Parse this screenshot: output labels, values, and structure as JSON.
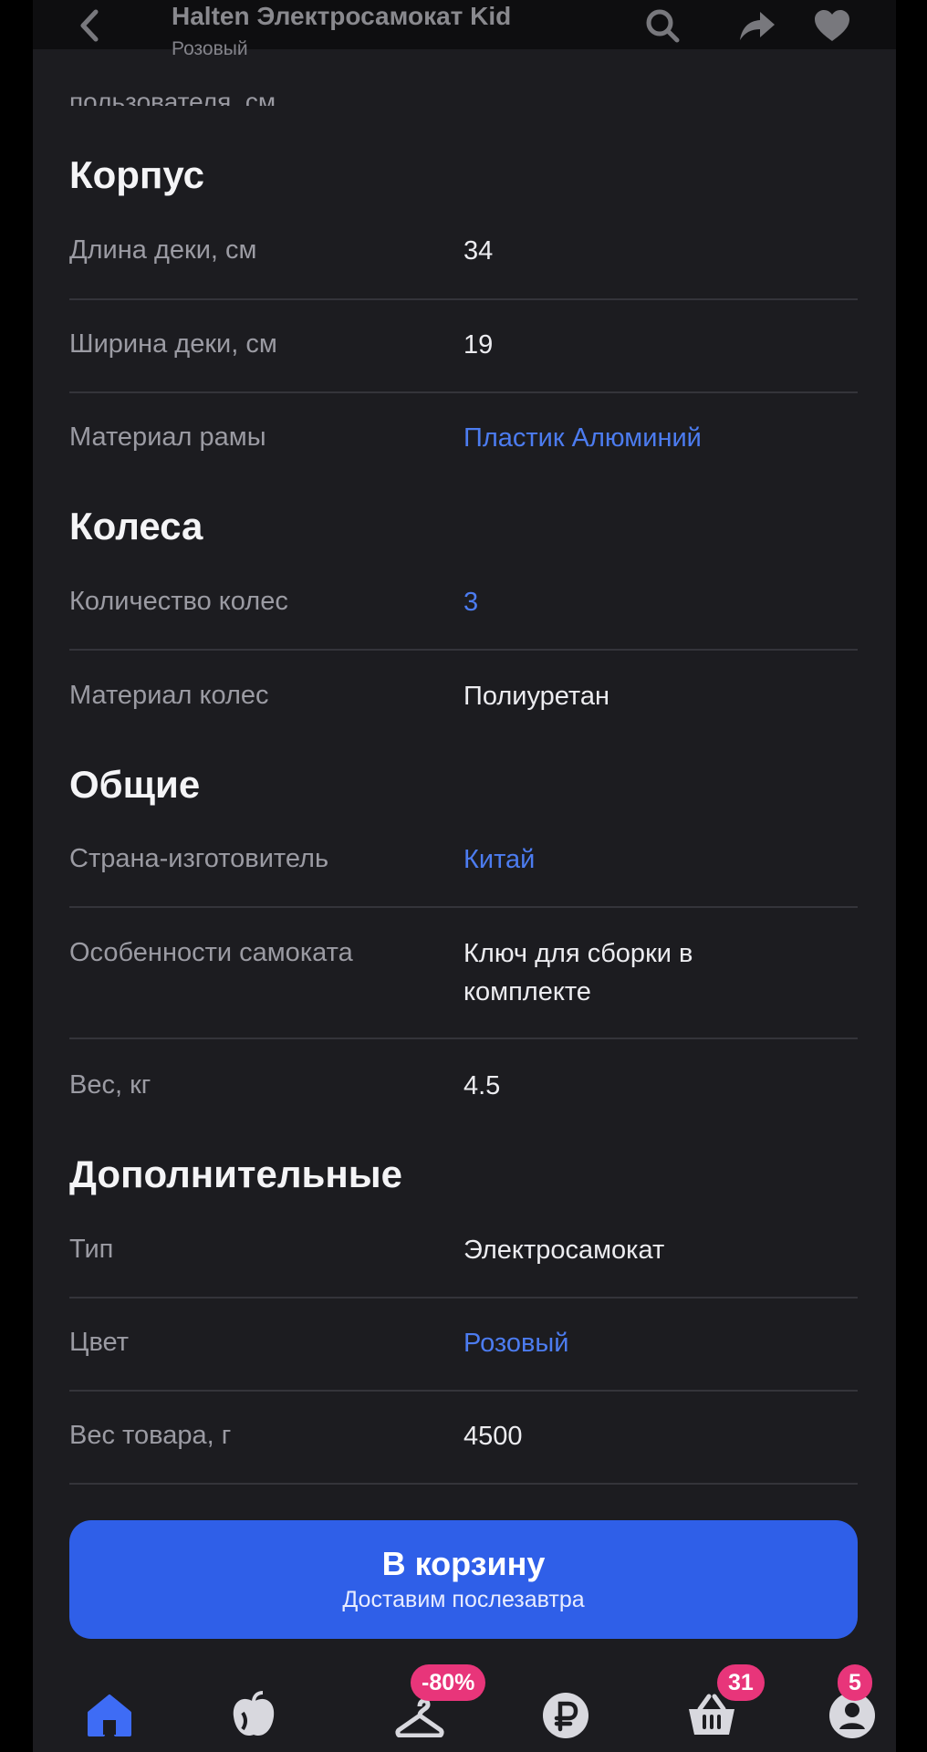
{
  "header": {
    "title": "Halten Электросамокат Kid",
    "subtitle": "Розовый",
    "cut_text": "пользователя, см"
  },
  "sections": [
    {
      "title": "Корпус",
      "rows": [
        {
          "label": "Длина деки, см",
          "value": "34",
          "link": false
        },
        {
          "label": "Ширина деки, см",
          "value": "19",
          "link": false
        },
        {
          "label": "Материал рамы",
          "value": "Пластик Алюминий",
          "link": true
        }
      ]
    },
    {
      "title": "Колеса",
      "rows": [
        {
          "label": "Количество колес",
          "value": "3",
          "link": true
        },
        {
          "label": "Материал колес",
          "value": "Полиуретан",
          "link": false
        }
      ]
    },
    {
      "title": "Общие",
      "rows": [
        {
          "label": "Страна-изготовитель",
          "value": "Китай",
          "link": true
        },
        {
          "label": "Особенности самоката",
          "value": "Ключ для сборки в комплекте",
          "link": false
        },
        {
          "label": "Вес, кг",
          "value": "4.5",
          "link": false
        }
      ]
    },
    {
      "title": "Дополнительные",
      "rows": [
        {
          "label": "Тип",
          "value": "Электросамокат",
          "link": false
        },
        {
          "label": "Цвет",
          "value": "Розовый",
          "link": true
        },
        {
          "label": "Вес товара, г",
          "value": "4500",
          "link": false
        }
      ]
    }
  ],
  "cart_button": {
    "label": "В корзину",
    "sublabel": "Доставим послезавтра"
  },
  "bottom_nav": {
    "items": [
      {
        "icon": "home-icon",
        "badge": ""
      },
      {
        "icon": "catalog-icon",
        "badge": ""
      },
      {
        "icon": "sale-hanger-icon",
        "badge": "-80%"
      },
      {
        "icon": "ruble-icon",
        "badge": ""
      },
      {
        "icon": "basket-icon",
        "badge": "31"
      },
      {
        "icon": "profile-icon",
        "badge": "5"
      }
    ]
  },
  "colors": {
    "accent": "#2f5fe8",
    "link": "#4c7cf0",
    "badge": "#e8357a",
    "background": "#1c1c20"
  }
}
